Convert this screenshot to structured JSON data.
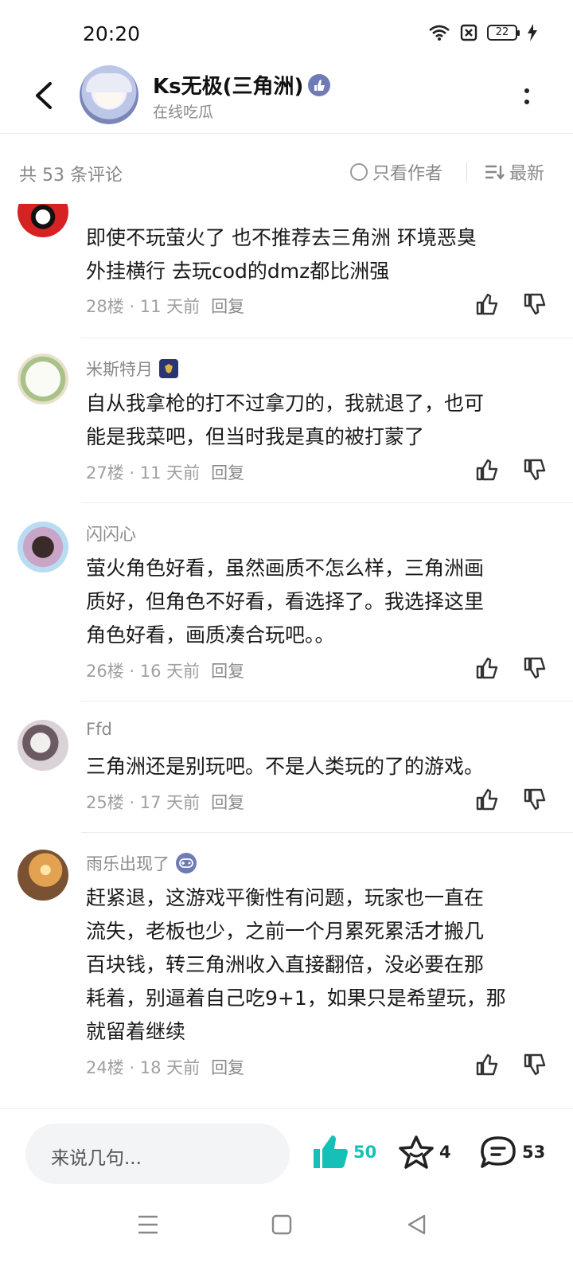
{
  "status_bar": {
    "time": "20:20",
    "battery": "22"
  },
  "header": {
    "title": "Ks无极(三角洲)",
    "subtitle": "在线吃瓜"
  },
  "filter": {
    "count_label": "共 53 条评论",
    "only_author": "只看作者",
    "sort": "最新"
  },
  "comments": [
    {
      "name": "",
      "text_lines": [
        "即使不玩萤火了 也不推荐去三角洲 环境恶臭",
        "外挂横行  去玩cod的dmz都比洲强"
      ],
      "floor": "28楼",
      "time": "11 天前",
      "reply": "回复"
    },
    {
      "name": "米斯特月",
      "text_lines": [
        "自从我拿枪的打不过拿刀的，我就退了，也可",
        "能是我菜吧，但当时我是真的被打蒙了"
      ],
      "floor": "27楼",
      "time": "11 天前",
      "reply": "回复"
    },
    {
      "name": "闪闪心",
      "text_lines": [
        "萤火角色好看，虽然画质不怎么样，三角洲画",
        "质好，但角色不好看，看选择了。我选择这里",
        "角色好看，画质凑合玩吧。。"
      ],
      "floor": "26楼",
      "time": "16 天前",
      "reply": "回复"
    },
    {
      "name": "Ffd",
      "text_lines": [
        "三角洲还是别玩吧。不是人类玩的了的游戏。"
      ],
      "floor": "25楼",
      "time": "17 天前",
      "reply": "回复"
    },
    {
      "name": "雨乐出现了",
      "text_lines": [
        "赶紧退，这游戏平衡性有问题，玩家也一直在",
        "流失，老板也少，之前一个月累死累活才搬几",
        "百块钱，转三角洲收入直接翻倍，没必要在那",
        "耗着，别逼着自己吃9+1，如果只是希望玩，那",
        "就留着继续"
      ],
      "floor": "24楼",
      "time": "18 天前",
      "reply": "回复"
    }
  ],
  "bottom_bar": {
    "input_placeholder": "来说几句...",
    "like_count": "50",
    "fav_count": "4",
    "comment_count": "53"
  },
  "colors": {
    "accent": "#16c0b7",
    "muted": "#8a8a8a",
    "badge": "#6f7bb4"
  }
}
